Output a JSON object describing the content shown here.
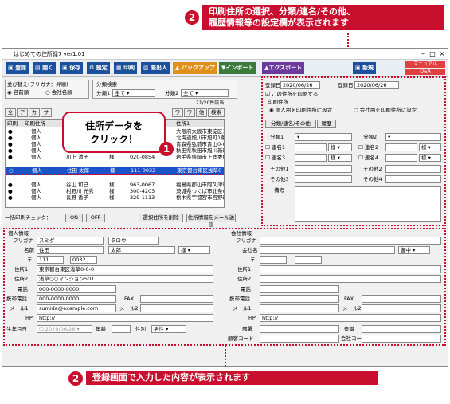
{
  "callouts": {
    "top_num": "2",
    "top_text1": "印刷住所の選択、分類/連名/その他、",
    "top_text2": "履歴情報等の設定欄が表示されます",
    "bottom_num": "2",
    "bottom_text": "登録画面で入力した内容が表示されます",
    "bubble_num": "1",
    "bubble_text1": "住所データを",
    "bubble_text2": "クリック！"
  },
  "window": {
    "title": "はじめての住所録7 ver1.01"
  },
  "toolbar": {
    "register": "登録",
    "open": "開く",
    "save": "保存",
    "settings": "設定",
    "print": "印刷",
    "sender": "差出人",
    "backup": "バックアップ",
    "import": "インポート",
    "export": "エクスポート",
    "new": "新規",
    "manual": "マニュアル",
    "qa": "Q&A"
  },
  "sort": {
    "title": "並び替え(フリガナ：昇順)",
    "name_order": "名前順",
    "company_order": "会社名順"
  },
  "category_search": {
    "title": "分類検索",
    "cat1_label": "分類1",
    "cat1_value": "全て",
    "cat2_label": "分類2",
    "cat2_value": "全て",
    "count": "21/20件該当"
  },
  "tabs": [
    "全",
    "ア",
    "カ",
    "サ",
    "タ",
    "ナ",
    "ハ",
    "マ",
    "ヤ",
    "ラ",
    "ワ",
    "ワ",
    "他",
    "検索"
  ],
  "list": {
    "headers": [
      "印刷",
      "印刷住所",
      "",
      "",
      "",
      "",
      "住所1"
    ],
    "rows": [
      {
        "mark": "●",
        "type": "個人",
        "name": "",
        "honor": "",
        "tel": "",
        "addr": "大阪府大阪市東淀区1-0"
      },
      {
        "mark": "●",
        "type": "個人",
        "name": "",
        "honor": "",
        "tel": "",
        "addr": "北海道旭川市旭町1条0-"
      },
      {
        "mark": "●",
        "type": "個人",
        "name": "",
        "honor": "",
        "tel": "",
        "addr": "青森県弘前市青山0-0-0"
      },
      {
        "mark": "●",
        "type": "個人",
        "name": "",
        "honor": "",
        "tel": "",
        "addr": "秋田県秋田市旭川新町0"
      },
      {
        "mark": "●",
        "type": "個人",
        "name": "川上 清子",
        "honor": "様",
        "tel": "020-0854",
        "addr": "岩手県盛岡市上鹿妻0-0"
      },
      {
        "mark": "○",
        "type": "個人",
        "name": "住田 太郎",
        "honor": "様",
        "tel": "111-0032",
        "addr": "東京都台東区浅草0-0-0"
      },
      {
        "mark": "●",
        "type": "個人",
        "name": "谷山 和己",
        "honor": "様",
        "tel": "963-0067",
        "addr": "福島県郡山市阿久津町0"
      },
      {
        "mark": "●",
        "type": "個人",
        "name": "村野川 光秀",
        "honor": "様",
        "tel": "300-4203",
        "addr": "茨城県つくば市北条0-0"
      },
      {
        "mark": "●",
        "type": "個人",
        "name": "長野 香子",
        "honor": "様",
        "tel": "329-1113",
        "addr": "栃木県宇都宮市宮野町0"
      }
    ]
  },
  "list_footer": {
    "check": "一括印刷チェック：",
    "on": "ON",
    "off": "OFF",
    "delete": "選択住所を削除",
    "mail": "住所情報をメール送信"
  },
  "right": {
    "reg_date_label": "登録日",
    "reg_date": "2020/06/26",
    "upd_date_label": "登録日",
    "upd_date": "2020/06/26",
    "print_check": "この住所を印刷する",
    "print_addr": "印刷住所",
    "print_home": "個人用を印刷住所に設定",
    "print_company": "会社用を印刷住所に設定",
    "tab1": "分類/連名/その他",
    "tab2": "履歴",
    "cat1": "分類1",
    "cat2": "分類2",
    "ren1": "連名1",
    "ren2": "連名2",
    "ren3": "連名3",
    "ren4": "連名4",
    "sama": "様",
    "other1": "その他1",
    "other2": "その他2",
    "other3": "その他3",
    "other4": "その他4",
    "memo": "備考"
  },
  "personal": {
    "title": "個人情報",
    "furigana_label": "フリガナ",
    "furigana1": "スミダ",
    "furigana2": "タロウ",
    "name_label": "名前",
    "name1": "住田",
    "name2": "太郎",
    "honor": "様",
    "zip_label": "〒",
    "zip1": "111",
    "zip2": "0032",
    "addr1_label": "住所1",
    "addr1": "東京都台東区浅草0-0-0",
    "addr2_label": "住所2",
    "addr2": "浅草○○マンション501",
    "tel_label": "電話",
    "tel": "000-0000-0000",
    "fax_label": "FAX",
    "mobile_label": "携帯電話",
    "mobile": "000-0000-0000",
    "mail1_label": "メール1",
    "mail1": "sumida@example.com",
    "mail2_label": "メール2",
    "hp_label": "HP",
    "hp": "http://",
    "birth_label": "生年月日",
    "birth": "2020/06/26",
    "age_label": "年齢",
    "gender_label": "性別",
    "gender": "男性"
  },
  "company": {
    "title": "会社情報",
    "furigana_label": "フリガナ",
    "name_label": "会社名",
    "honor": "御中",
    "zip_label": "〒",
    "addr1_label": "住所1",
    "addr2_label": "住所2",
    "tel_label": "電話",
    "mobile_label": "携帯電話",
    "fax_label": "FAX",
    "mail1_label": "メール1",
    "mail2_label": "メール2",
    "hp_label": "HP",
    "hp": "http://",
    "dept_label": "部署",
    "post_label": "役職",
    "client_label": "顧客コード",
    "code_label": "会社コード"
  }
}
